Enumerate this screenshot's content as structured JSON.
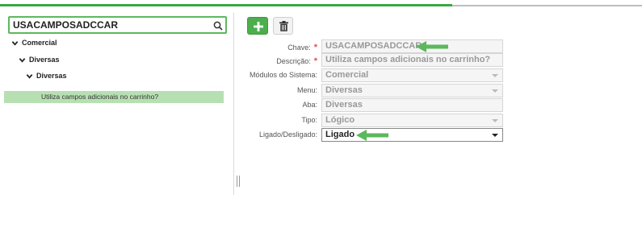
{
  "search": {
    "value": "USACAMPOSADCCAR"
  },
  "tree": {
    "level1": "Comercial",
    "level2": "Diversas",
    "level3": "Diversas",
    "leaf": "Utiliza campos adicionais no carrinho?"
  },
  "form": {
    "chave": {
      "label": "Chave:",
      "value": "USACAMPOSADCCAR"
    },
    "descricao": {
      "label": "Descrição:",
      "value": "Utiliza campos adicionais no carrinho?"
    },
    "modulos": {
      "label": "Módulos do Sistema:",
      "value": "Comercial"
    },
    "menu": {
      "label": "Menu:",
      "value": "Diversas"
    },
    "aba": {
      "label": "Aba:",
      "value": "Diversas"
    },
    "tipo": {
      "label": "Tipo:",
      "value": "Lógico"
    },
    "ligado": {
      "label": "Ligado/Desligado:",
      "value": "Ligado"
    },
    "required_mark": "*"
  },
  "colors": {
    "accent_green": "#4cae4c",
    "selected_row": "#b7e0b2",
    "required": "#d9534f",
    "arrow": "#5cb85c"
  }
}
